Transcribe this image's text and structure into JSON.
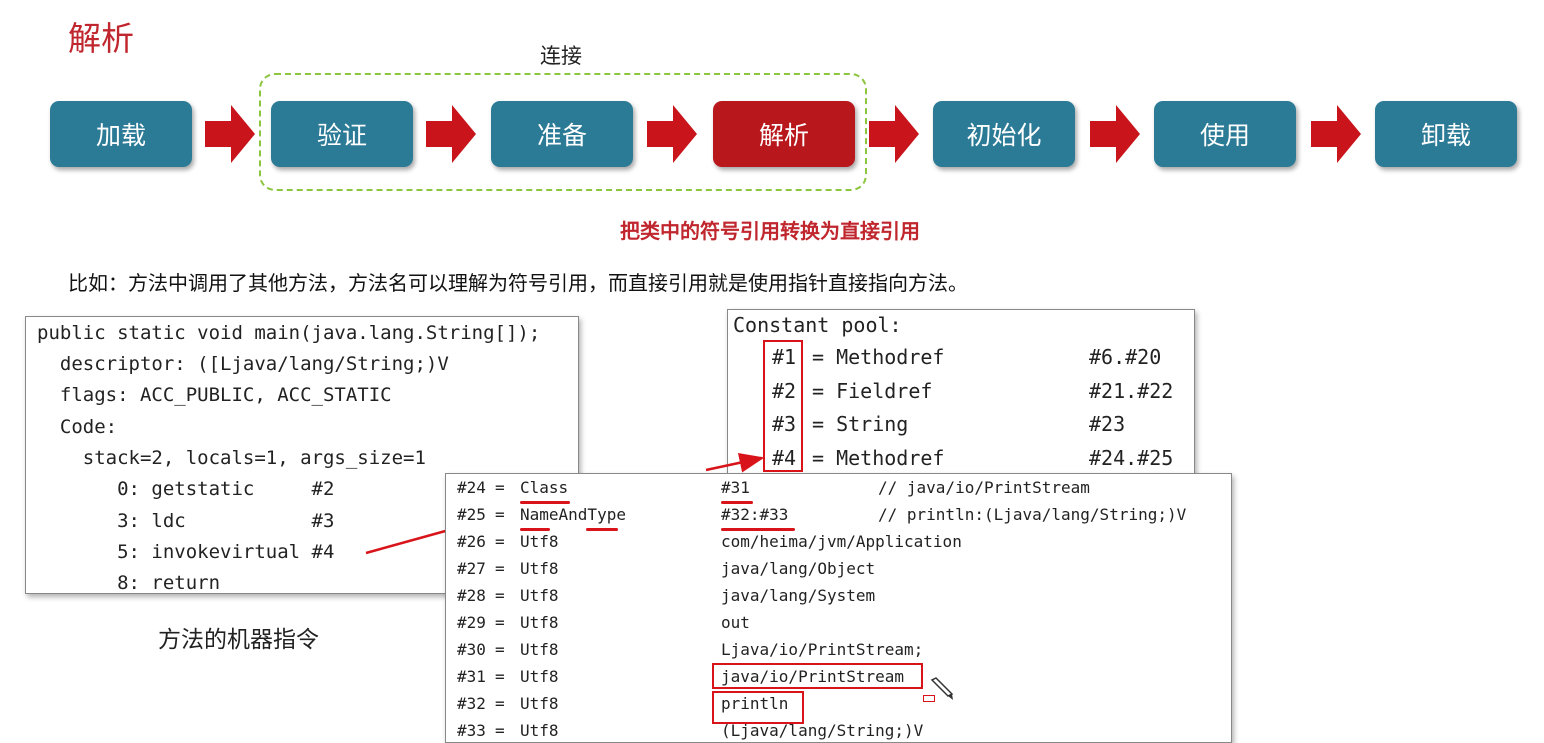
{
  "page": {
    "title": "解析",
    "group_label": "连接",
    "subtitle": "把类中的符号引用转换为直接引用",
    "example": "比如：方法中调用了其他方法，方法名可以理解为符号引用，而直接引用就是使用指针直接指向方法。",
    "caption": "方法的机器指令"
  },
  "stages": [
    "加载",
    "验证",
    "准备",
    "解析",
    "初始化",
    "使用",
    "卸载"
  ],
  "active_stage": "解析",
  "colors": {
    "accent_red": "#c0262d",
    "stage_blue": "#2b7a96",
    "stage_active": "#b8181c",
    "group_dash": "#8cc63f"
  },
  "bytecode_lines": [
    "public static void main(java.lang.String[]);",
    "  descriptor: ([Ljava/lang/String;)V",
    "  flags: ACC_PUBLIC, ACC_STATIC",
    "  Code:",
    "    stack=2, locals=1, args_size=1",
    "       0: getstatic     #2",
    "       3: ldc           #3",
    "       5: invokevirtual #4",
    "       8: return"
  ],
  "constant_pool_header": "Constant pool:",
  "constant_pool_top": [
    {
      "ref": "#1",
      "type": "= Methodref",
      "value": "#6.#20"
    },
    {
      "ref": "#2",
      "type": "= Fieldref",
      "value": "#21.#22"
    },
    {
      "ref": "#3",
      "type": "= String",
      "value": "#23"
    },
    {
      "ref": "#4",
      "type": "= Methodref",
      "value": "#24.#25"
    }
  ],
  "constant_pool_entries": [
    {
      "ref": "#24",
      "type": "Class",
      "value": "#31",
      "comment": "// java/io/PrintStream"
    },
    {
      "ref": "#25",
      "type": "NameAndType",
      "value": "#32:#33",
      "comment": "// println:(Ljava/lang/String;)V"
    },
    {
      "ref": "#26",
      "type": "Utf8",
      "value": "com/heima/jvm/Application",
      "comment": ""
    },
    {
      "ref": "#27",
      "type": "Utf8",
      "value": "java/lang/Object",
      "comment": ""
    },
    {
      "ref": "#28",
      "type": "Utf8",
      "value": "java/lang/System",
      "comment": ""
    },
    {
      "ref": "#29",
      "type": "Utf8",
      "value": "out",
      "comment": ""
    },
    {
      "ref": "#30",
      "type": "Utf8",
      "value": "Ljava/io/PrintStream;",
      "comment": ""
    },
    {
      "ref": "#31",
      "type": "Utf8",
      "value": "java/io/PrintStream",
      "comment": ""
    },
    {
      "ref": "#32",
      "type": "Utf8",
      "value": "println",
      "comment": ""
    },
    {
      "ref": "#33",
      "type": "Utf8",
      "value": "(Ljava/lang/String;)V",
      "comment": ""
    }
  ]
}
